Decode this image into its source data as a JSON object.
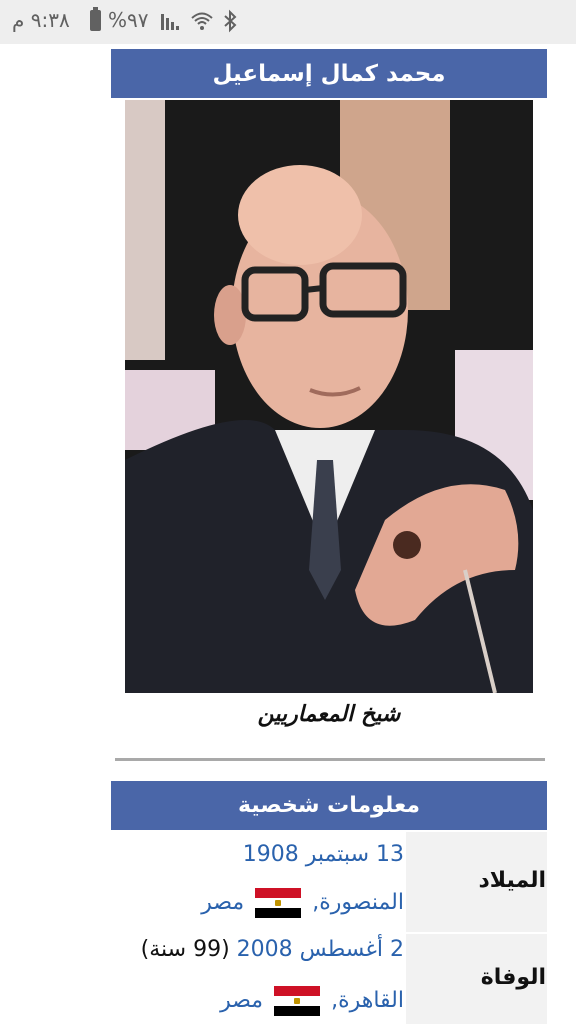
{
  "status_bar": {
    "time": "٩:٣٨ م",
    "battery": "%٩٧",
    "icons": [
      "battery-icon",
      "signal-icon",
      "wifi-icon",
      "bluetooth-icon"
    ]
  },
  "infobox": {
    "title": "محمد كمال إسماعيل",
    "image_caption": "شيخ المعماريين",
    "section_header": "معلومات شخصية",
    "birth": {
      "label": "الميلاد",
      "date": "13 سبتمبر 1908",
      "city": "المنصورة,",
      "country": "مصر"
    },
    "death": {
      "label": "الوفاة",
      "date": "2 أغسطس 2008",
      "age": "(99 سنة)",
      "city": "القاهرة,",
      "country": "مصر"
    }
  },
  "colors": {
    "header_blue": "#4a66a8",
    "link_blue": "#2a62ad",
    "label_bg": "#f2f2f2"
  }
}
